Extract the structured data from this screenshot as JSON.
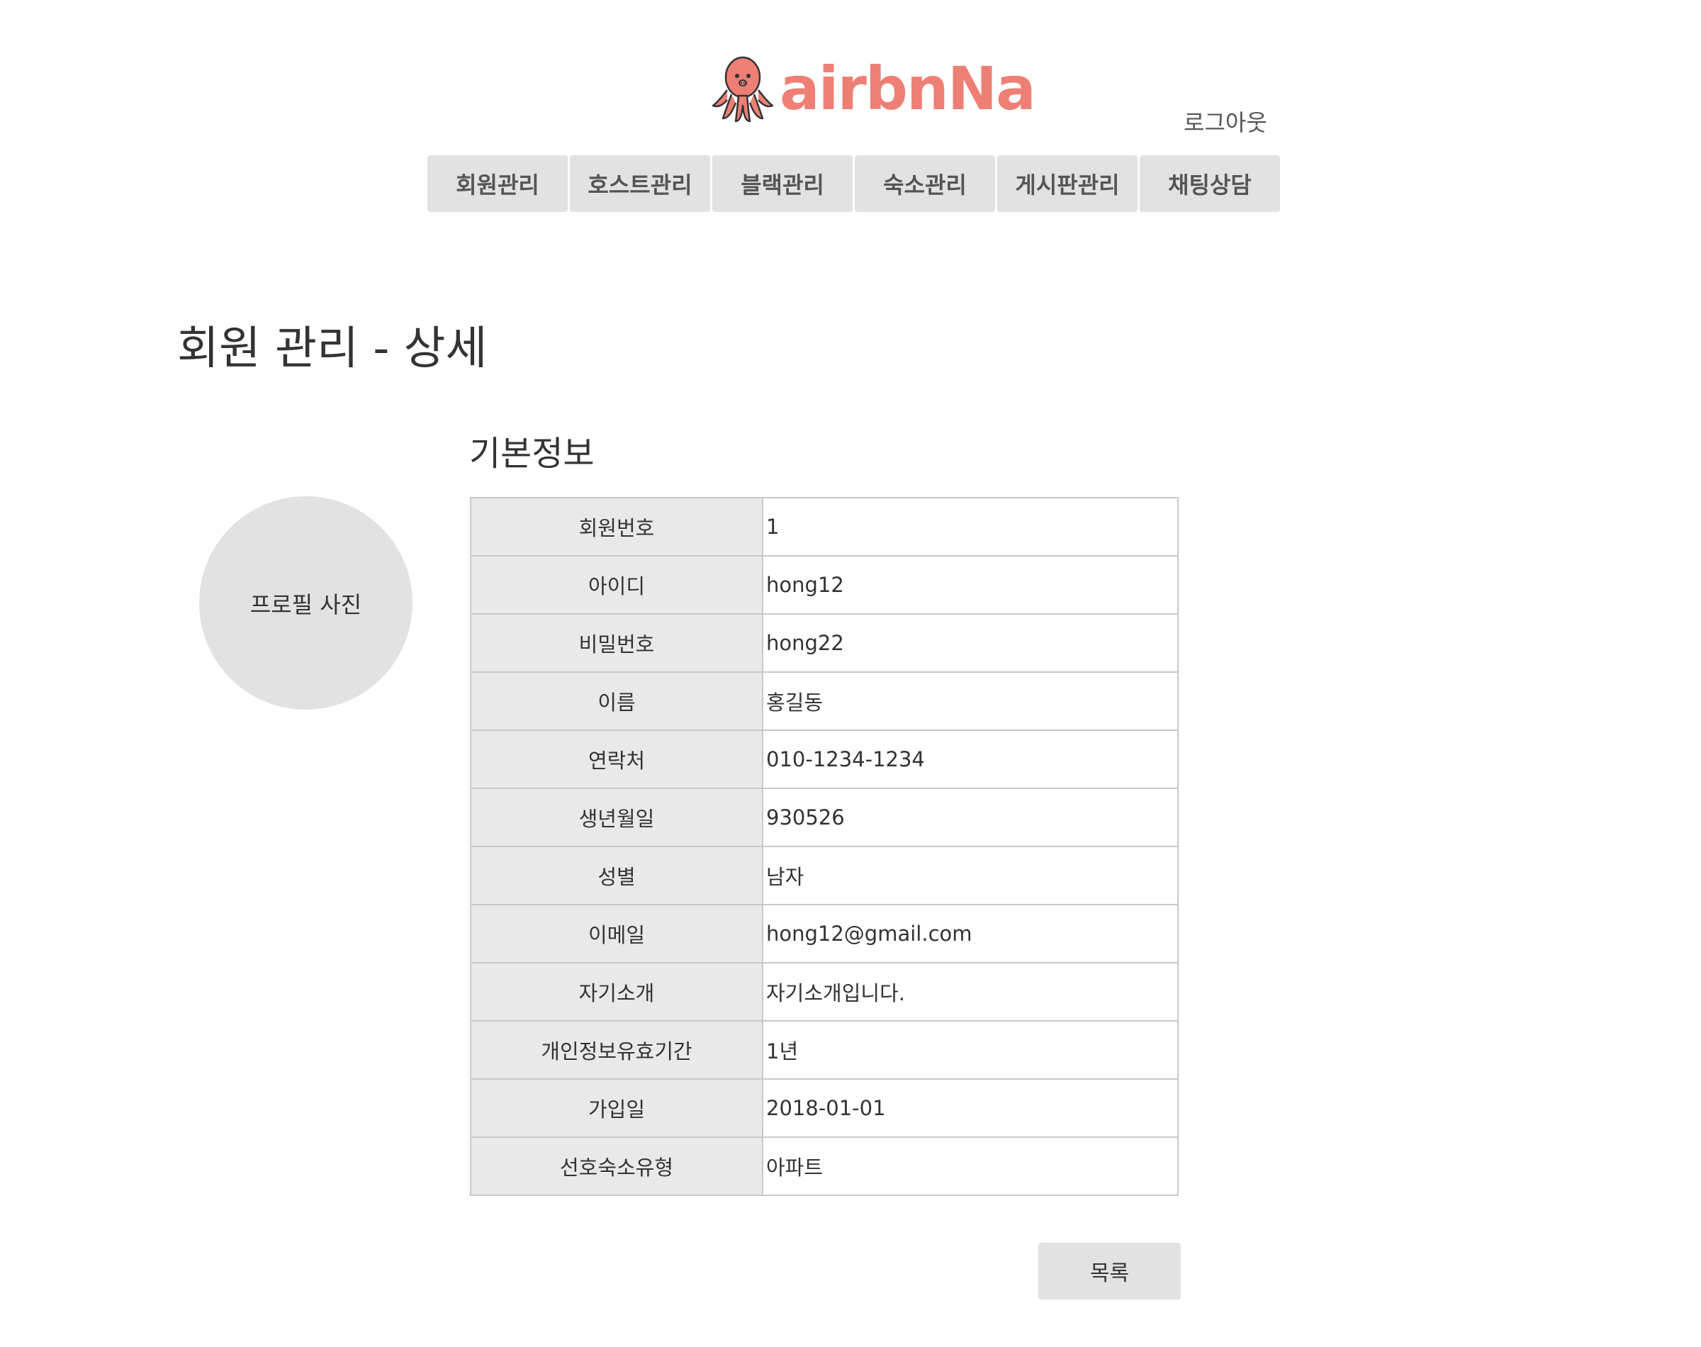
{
  "header": {
    "logo_text": "airbnNa",
    "logout_label": "로그아웃"
  },
  "nav": {
    "items": [
      {
        "label": "회원관리"
      },
      {
        "label": "호스트관리"
      },
      {
        "label": "블랙관리"
      },
      {
        "label": "숙소관리"
      },
      {
        "label": "게시판관리"
      },
      {
        "label": "채팅상담"
      }
    ]
  },
  "page": {
    "title": "회원 관리 - 상세",
    "section_title": "기본정보",
    "profile_placeholder": "프로필 사진",
    "list_button_label": "목록"
  },
  "member": {
    "rows": [
      {
        "label": "회원번호",
        "value": "1"
      },
      {
        "label": "아이디",
        "value": "hong12"
      },
      {
        "label": "비밀번호",
        "value": "hong22"
      },
      {
        "label": "이름",
        "value": "홍길동"
      },
      {
        "label": "연락처",
        "value": "010-1234-1234"
      },
      {
        "label": "생년월일",
        "value": "930526"
      },
      {
        "label": "성별",
        "value": "남자"
      },
      {
        "label": "이메일",
        "value": "hong12@gmail.com"
      },
      {
        "label": "자기소개",
        "value": "자기소개입니다."
      },
      {
        "label": "개인정보유효기간",
        "value": "1년"
      },
      {
        "label": "가입일",
        "value": "2018-01-01"
      },
      {
        "label": "선호숙소유형",
        "value": "아파트"
      }
    ]
  },
  "colors": {
    "brand": "#ee7f74",
    "button_bg": "#e2e2e2",
    "table_key_bg": "#e9e9e9",
    "border": "#c8c8c8"
  },
  "icons": {
    "logo_mascot": "octopus-icon"
  }
}
